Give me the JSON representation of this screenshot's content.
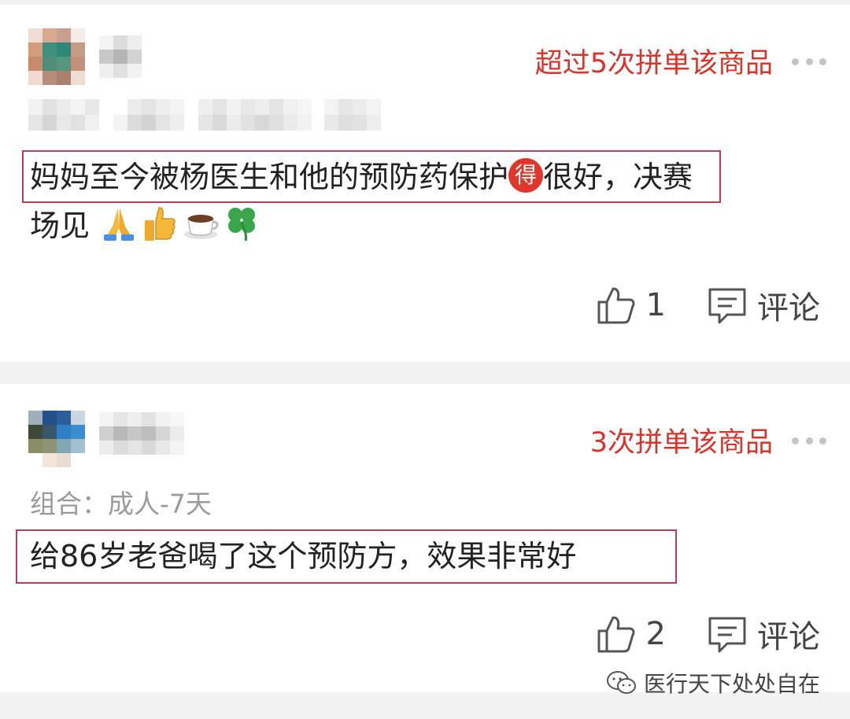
{
  "reviews": [
    {
      "badge": "超过5次拼单该商品",
      "text_before": "妈妈至今被杨医生和他的预防药保护",
      "de_char": "得",
      "text_after": "很好，决赛",
      "text_line2": "场见",
      "emojis": [
        "folded-hands-emoji",
        "thumbs-up-emoji",
        "coffee-emoji",
        "four-leaf-clover-emoji"
      ],
      "like_count": "1",
      "comment_label": "评论"
    },
    {
      "badge": "3次拼单该商品",
      "variant_label": "组合：成人-7天",
      "text": "给86岁老爸喝了这个预防方，效果非常好",
      "like_count": "2",
      "comment_label": "评论"
    }
  ],
  "watermark": {
    "icon": "wechat-icon",
    "text": "医行天下处处自在"
  },
  "colors": {
    "badge": "#d9342b",
    "highlight_border": "#c03a5a",
    "divider": "#f2f2f2"
  }
}
